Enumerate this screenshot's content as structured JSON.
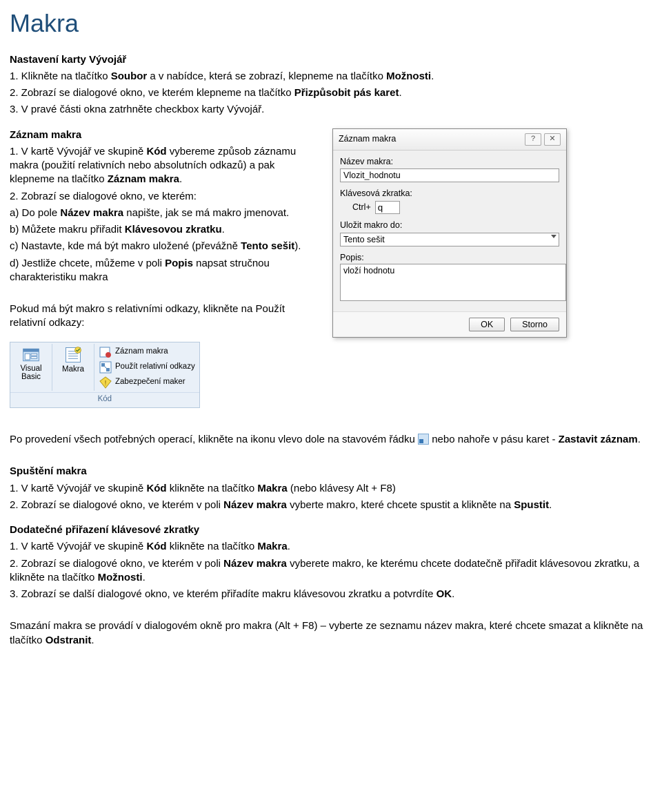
{
  "title": "Makra",
  "sec1": {
    "heading": "Nastavení karty Vývojář",
    "pre1": "1. Klikněte na tlačítko ",
    "b1": "Soubor",
    "mid1": " a v nabídce, která se zobrazí, klepneme na tlačítko ",
    "b2": "Možnosti",
    "tail1": ".",
    "pre2": "2. Zobrazí se dialogové okno, ve kterém klepneme na tlačítko ",
    "b3": "Přizpůsobit pás karet",
    "tail2": ".",
    "line3": "3. V pravé části okna zatrhněte checkbox karty Vývojář."
  },
  "sec2": {
    "heading": "Záznam makra",
    "pre1": "1. V kartě Vývojář ve skupině ",
    "b1": "Kód",
    "mid1": " vybereme způsob záznamu makra (použití relativních nebo absolutních odkazů) a pak klepneme na tlačítko ",
    "b2": "Záznam makra",
    "tail1": ".",
    "line2a": "2. Zobrazí se dialogové okno, ve kterém:",
    "preA": "a) Do pole ",
    "bA": "Název makra",
    "tailA": " napište, jak se má makro jmenovat.",
    "preB": "b) Můžete makru přiřadit ",
    "bB": "Klávesovou zkratku",
    "tailB": ".",
    "preC": "c) Nastavte, kde má být makro uložené (převážně ",
    "bC": "Tento sešit",
    "tailC": ").",
    "preD": "d) Jestliže chcete, můžeme v poli ",
    "bD": "Popis",
    "tailD": " napsat stručnou charakteristiku makra"
  },
  "relativni": "Pokud má být makro s relativními odkazy, klikněte na Použít relativní odkazy:",
  "dlg": {
    "title": "Záznam makra",
    "lbl_nazev": "Název makra:",
    "val_nazev": "Vlozit_hodnotu",
    "lbl_zkratka": "Klávesová zkratka:",
    "ctrl": "Ctrl+",
    "zkratka": "q",
    "lbl_ulozit": "Uložit makro do:",
    "val_ulozit": "Tento sešit",
    "lbl_popis": "Popis:",
    "val_popis": "vloží hodnotu",
    "ok": "OK",
    "storno": "Storno"
  },
  "ribbon": {
    "vb": "Visual Basic",
    "makra": "Makra",
    "rec": "Záznam makra",
    "rel": "Použít relativní odkazy",
    "sec": "Zabezpečení maker",
    "group": "Kód"
  },
  "after": {
    "text1": "Po provedení všech potřebných operací, klikněte na ikonu vlevo dole na stavovém řádku ",
    "text2": " nebo nahoře v pásu karet - ",
    "b": "Zastavit záznam",
    "tail": "."
  },
  "sec3": {
    "heading": "Spuštění makra",
    "pre1": "1. V kartě Vývojář ve skupině ",
    "b1": "Kód",
    "mid1": " klikněte na tlačítko ",
    "b2": "Makra",
    "tail1": " (nebo klávesy Alt + F8)",
    "pre2": "2. Zobrazí se dialogové okno, ve kterém v poli ",
    "b3": "Název makra",
    "mid2": " vyberte makro, které chcete spustit a klikněte na ",
    "b4": "Spustit",
    "tail2": "."
  },
  "sec4": {
    "heading": "Dodatečné přiřazení klávesové zkratky",
    "pre1": "1. V kartě Vývojář ve skupině ",
    "b1": "Kód",
    "mid1": " klikněte na tlačítko ",
    "b2": "Makra",
    "tail1": ".",
    "pre2": "2. Zobrazí se dialogové okno, ve kterém v poli ",
    "b3": "Název makra",
    "mid2": " vyberete makro, ke kterému chcete dodatečně přiřadit klávesovou zkratku, a klikněte na tlačítko ",
    "b4": "Možnosti",
    "tail2": ".",
    "pre3": "3. Zobrazí se další dialogové okno, ve kterém přiřadíte makru klávesovou zkratku a potvrdíte ",
    "b5": "OK",
    "tail3": "."
  },
  "sec5": {
    "text1": "Smazání makra se provádí v dialogovém okně pro makra (Alt + F8) – vyberte ze seznamu název makra, které chcete smazat a klikněte na tlačítko ",
    "b1": "Odstranit",
    "tail1": "."
  }
}
